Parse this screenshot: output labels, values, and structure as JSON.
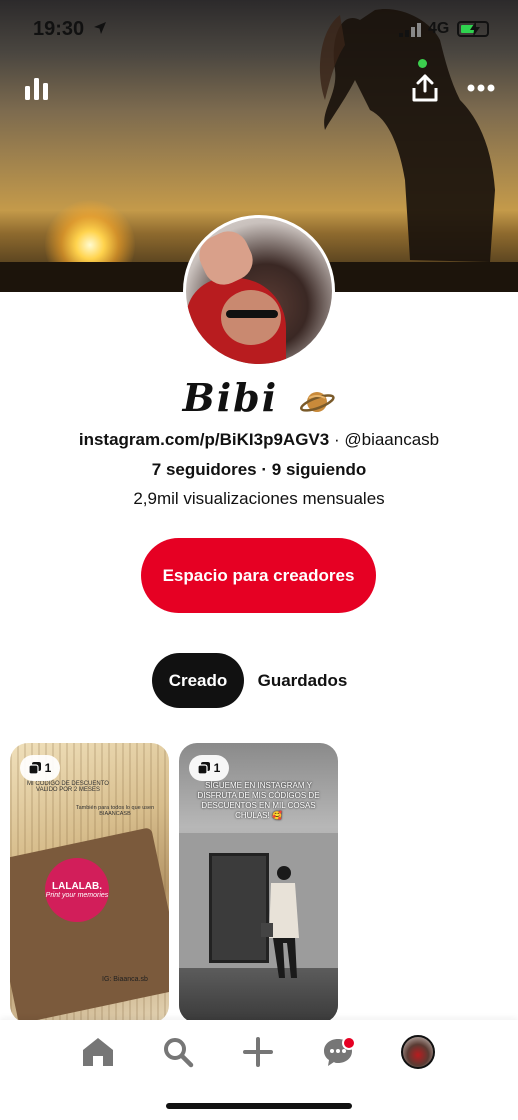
{
  "status_bar": {
    "time": "19:30",
    "network": "4G"
  },
  "profile": {
    "name": "Bibi",
    "instagram_url": "instagram.com/p/BiKI3p9AGV3",
    "separator": "·",
    "handle": "@biaancasb",
    "followers": "7 seguidores",
    "following": "9 siguiendo",
    "monthly_views": "2,9mil visualizaciones mensuales"
  },
  "creator_button": {
    "label": "Espacio para creadores"
  },
  "tabs": [
    {
      "label": "Creado",
      "active": true
    },
    {
      "label": "Guardados",
      "active": false
    }
  ],
  "pins": [
    {
      "badge_count": "1",
      "text_top": "MI CODIGO DE DESCUENTO VALIDO POR 2 MESES",
      "text_mid": "También para todos lo que usen BIAANCASB",
      "sticker_title": "LALALAB.",
      "sticker_sub": "Print your memories",
      "text_bottom": "IG: Biaanca.sb"
    },
    {
      "badge_count": "1",
      "caption": "SÍGUEME EN INSTAGRAM Y DISFRUTA DE MIS CÓDIGOS DE DESCUENTOS EN MIL COSAS CHULAS! 🥰"
    }
  ],
  "icons": {
    "stats": "stats-bar-icon",
    "share": "share-icon",
    "more": "more-dots-icon",
    "home": "home-icon",
    "search": "search-icon",
    "add": "plus-icon",
    "messages": "chat-bubble-icon",
    "profile": "profile-avatar-icon",
    "name_emoji": "ringed-planet-icon"
  },
  "colors": {
    "primary": "#e60023",
    "active_tab": "#111111",
    "online_dot": "#3ccf4e"
  }
}
